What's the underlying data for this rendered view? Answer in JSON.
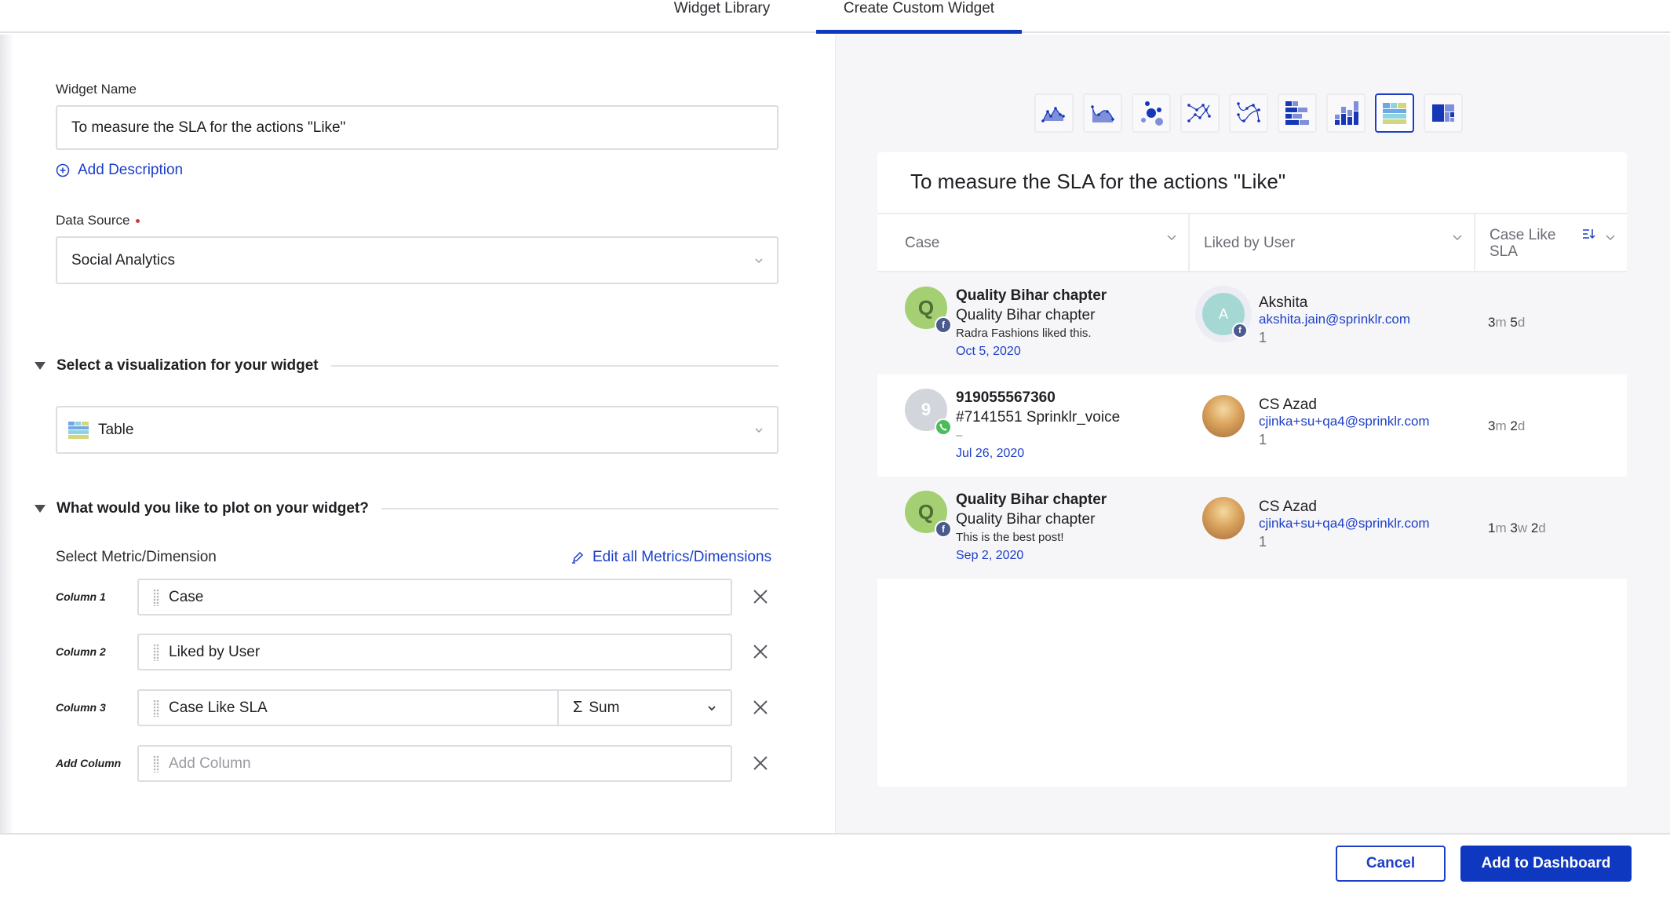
{
  "tabs": [
    {
      "label": "Widget Library",
      "active": false
    },
    {
      "label": "Create Custom Widget",
      "active": true
    }
  ],
  "form": {
    "widget_name_label": "Widget Name",
    "widget_name_value": "To measure the SLA for the actions \"Like\"",
    "add_description_label": "Add Description",
    "data_source_label": "Data Source",
    "data_source_value": "Social Analytics",
    "visualization_section_title": "Select a visualization for your widget",
    "visualization_value": "Table",
    "plot_section_title": "What would you like to plot on your widget?",
    "select_metric_label": "Select Metric/Dimension",
    "edit_all_label": "Edit all Metrics/Dimensions",
    "columns": [
      {
        "label": "Column 1",
        "value": "Case"
      },
      {
        "label": "Column 2",
        "value": "Liked by User"
      },
      {
        "label": "Column 3",
        "value": "Case Like SLA",
        "aggregation": "Sum"
      },
      {
        "label": "Add Column",
        "placeholder": "Add Column"
      }
    ]
  },
  "viz_types": [
    {
      "name": "area-chart"
    },
    {
      "name": "spline-area-chart"
    },
    {
      "name": "bubble-chart"
    },
    {
      "name": "line-chart"
    },
    {
      "name": "spline-chart"
    },
    {
      "name": "stacked-bar-chart"
    },
    {
      "name": "stacked-column-chart"
    },
    {
      "name": "table",
      "active": true
    },
    {
      "name": "treemap"
    }
  ],
  "preview": {
    "title": "To measure the SLA for the actions \"Like\"",
    "headers": [
      "Case",
      "Liked by User",
      "Case Like SLA"
    ],
    "rows": [
      {
        "avatar_letter": "Q",
        "channel": "facebook",
        "case_title": "Quality Bihar chapter",
        "case_subtitle": "Quality Bihar chapter",
        "case_message": "Radra Fashions liked this.",
        "case_date": "Oct 5, 2020",
        "user_avatar_letter": "A",
        "user_name": "Akshita",
        "user_email": "akshita.jain@sprinklr.com",
        "user_count": "1",
        "sla": [
          {
            "n": "3",
            "u": "m"
          },
          {
            "n": "5",
            "u": "d"
          }
        ]
      },
      {
        "avatar_letter": "9",
        "channel": "phone",
        "case_title": "919055567360",
        "case_subtitle": "#7141551 Sprinklr_voice",
        "case_message": "–",
        "case_date": "Jul 26, 2020",
        "user_avatar_letter": "",
        "user_name": "CS Azad",
        "user_email": "cjinka+su+qa4@sprinklr.com",
        "user_count": "1",
        "sla": [
          {
            "n": "3",
            "u": "m"
          },
          {
            "n": "2",
            "u": "d"
          }
        ]
      },
      {
        "avatar_letter": "Q",
        "channel": "facebook",
        "case_title": "Quality Bihar chapter",
        "case_subtitle": "Quality Bihar chapter",
        "case_message": "This is the best post!",
        "case_date": "Sep 2, 2020",
        "user_avatar_letter": "",
        "user_name": "CS Azad",
        "user_email": "cjinka+su+qa4@sprinklr.com",
        "user_count": "1",
        "sla": [
          {
            "n": "1",
            "u": "m"
          },
          {
            "n": "3",
            "u": "w"
          },
          {
            "n": "2",
            "u": "d"
          }
        ]
      }
    ]
  },
  "footer": {
    "cancel_label": "Cancel",
    "add_label": "Add to Dashboard"
  },
  "colors": {
    "accent": "#0f38c0",
    "link": "#1d3fc7",
    "required": "#d0383d",
    "panel_bg": "#f6f6f9"
  }
}
